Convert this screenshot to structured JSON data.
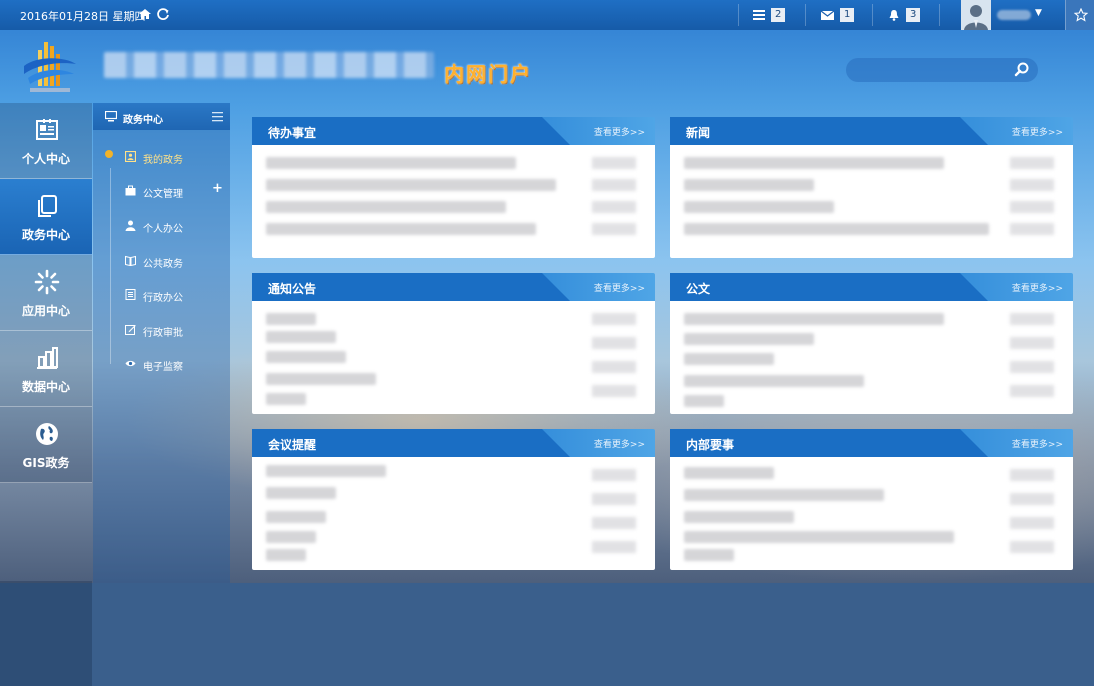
{
  "topbar": {
    "date": "2016年01月28日 星期四",
    "tasks_count": "2",
    "mail_count": "1",
    "notify_count": "3"
  },
  "header": {
    "portal_title": "内网门户",
    "search_placeholder": ""
  },
  "leftnav": [
    {
      "label": "个人中心",
      "icon": "id-card-icon"
    },
    {
      "label": "政务中心",
      "icon": "documents-icon"
    },
    {
      "label": "应用中心",
      "icon": "spinner-icon"
    },
    {
      "label": "数据中心",
      "icon": "bar-chart-icon"
    },
    {
      "label": "GIS政务",
      "icon": "globe-icon"
    }
  ],
  "subnav": {
    "title": "政务中心",
    "items": [
      {
        "label": "我的政务",
        "icon": "person-card-icon",
        "active": true
      },
      {
        "label": "公文管理",
        "icon": "briefcase-icon"
      },
      {
        "label": "个人办公",
        "icon": "user-icon"
      },
      {
        "label": "公共政务",
        "icon": "book-icon"
      },
      {
        "label": "行政办公",
        "icon": "list-doc-icon"
      },
      {
        "label": "行政审批",
        "icon": "edit-icon"
      },
      {
        "label": "电子监察",
        "icon": "eye-icon"
      }
    ]
  },
  "panels": [
    {
      "title": "待办事宜",
      "more": "查看更多>>"
    },
    {
      "title": "新闻",
      "more": "查看更多>>"
    },
    {
      "title": "通知公告",
      "more": "查看更多>>"
    },
    {
      "title": "公文",
      "more": "查看更多>>"
    },
    {
      "title": "会议提醒",
      "more": "查看更多>>"
    },
    {
      "title": "内部要事",
      "more": "查看更多>>"
    }
  ],
  "colors": {
    "accent": "#1f74c9",
    "title_orange": "#ffb12c",
    "active_dot": "#f2b32a"
  }
}
